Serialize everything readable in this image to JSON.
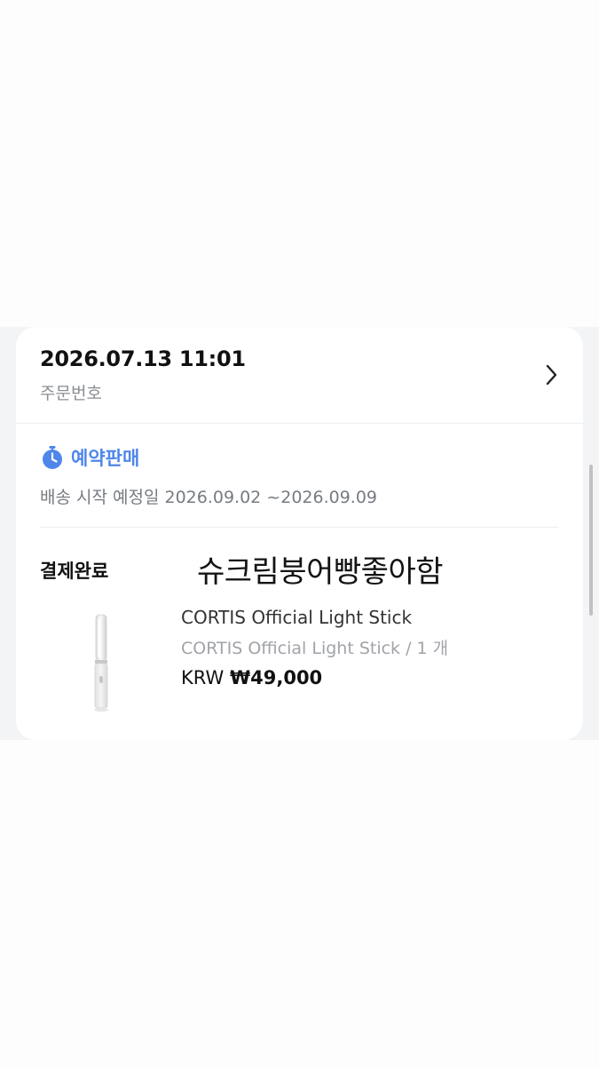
{
  "order": {
    "datetime": "2026.07.13 11:01",
    "number_label": "주문번호"
  },
  "preorder": {
    "icon": "stopwatch-icon",
    "label": "예약판매",
    "shipping_text": "배송 시작 예정일 2026.09.02 ~2026.09.09"
  },
  "payment": {
    "status": "결제완료"
  },
  "overlay_text": "슈크림붕어빵좋아함",
  "product": {
    "image": "light-stick-image",
    "name": "CORTIS Official Light Stick",
    "option": "CORTIS Official Light Stick / 1 개",
    "currency": "KRW",
    "price": "₩49,000"
  },
  "colors": {
    "accent": "#4f86ea",
    "background": "#f3f4f6",
    "card": "#ffffff"
  }
}
